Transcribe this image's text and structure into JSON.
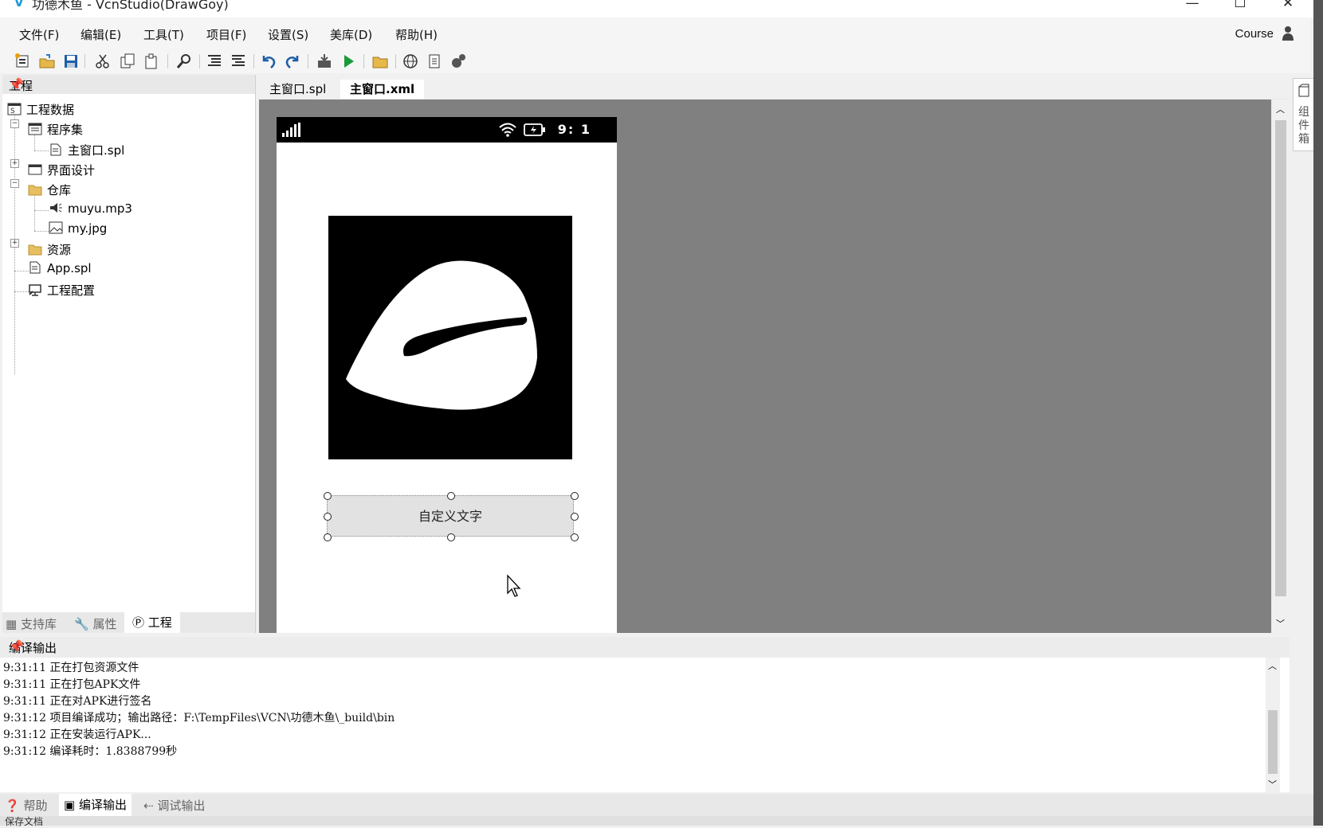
{
  "window": {
    "title": "功德木鱼 - VcnStudio(DrawGoy)",
    "controls": [
      "—",
      "☐",
      "✕"
    ]
  },
  "menu": [
    "文件(F)",
    "编辑(E)",
    "工具(T)",
    "项目(F)",
    "设置(S)",
    "美库(D)",
    "帮助(H)"
  ],
  "user": {
    "name": "Course"
  },
  "toolbar": {
    "icons": [
      "new-file-icon",
      "open-icon",
      "save-icon",
      "cut-icon",
      "copy-icon",
      "paste-icon",
      "find-icon",
      "indent-icon",
      "outdent-icon",
      "undo-icon",
      "redo-icon",
      "build-icon",
      "run-icon",
      "folder-icon",
      "globe-icon",
      "document-icon",
      "plugin-icon"
    ]
  },
  "project_panel": {
    "title": "工程",
    "tree": {
      "root": "工程数据",
      "assembly": "程序集",
      "main_spl": "主窗口.spl",
      "ui_design": "界面设计",
      "warehouse": "仓库",
      "mp3": "muyu.mp3",
      "jpg": "my.jpg",
      "resources": "资源",
      "app_spl": "App.spl",
      "config": "工程配置"
    },
    "tabs": {
      "lib": "支持库",
      "props": "属性",
      "project": "工程"
    }
  },
  "editor": {
    "tabs": [
      "主窗口.spl",
      "主窗口.xml"
    ],
    "active_tab": "主窗口.xml",
    "phone": {
      "time": "9: 1",
      "button_text": "自定义文字"
    }
  },
  "toolbox": {
    "label": "组件箱"
  },
  "output": {
    "title": "编译输出",
    "lines": [
      "9:31:11 正在打包资源文件",
      "9:31:11 正在打包APK文件",
      "9:31:11 正在对APK进行签名",
      "9:31:12 项目编译成功；输出路径：F:\\TempFiles\\VCN\\功德木鱼\\_build\\bin",
      "9:31:12 正在安装运行APK...",
      "9:31:12 编译耗时：1.8388799秒"
    ]
  },
  "bottom_tabs": {
    "help": "帮助",
    "compile": "编译输出",
    "debug": "调试输出"
  },
  "status": {
    "text": "保存文档"
  }
}
